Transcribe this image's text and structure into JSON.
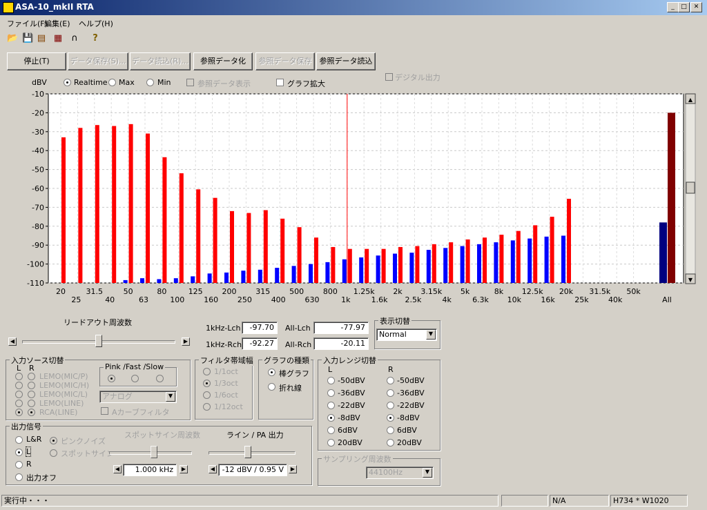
{
  "window": {
    "title": "ASA-10_mkII RTA"
  },
  "menu": [
    "ファイル(F)",
    "編集(E)",
    "ヘルプ(H)"
  ],
  "toolbar_buttons": [
    {
      "label": "停止(T)",
      "enabled": true
    },
    {
      "label": "データ保存(S)...",
      "enabled": false
    },
    {
      "label": "データ読込(R)...",
      "enabled": false
    },
    {
      "label": "参照データ化",
      "enabled": true
    },
    {
      "label": "参照データ保存",
      "enabled": false
    },
    {
      "label": "参照データ読込",
      "enabled": true
    }
  ],
  "digital_output": "デジタル出力",
  "display_mode": {
    "unit": "dBV",
    "options": [
      "Realtime",
      "Max",
      "Min"
    ],
    "selected": "Realtime",
    "ref_display": "参照データ表示",
    "graph_zoom": "グラフ拡大"
  },
  "chart_data": {
    "type": "bar",
    "ylim": [
      -110,
      -10
    ],
    "yticks": [
      -10,
      -20,
      -30,
      -40,
      -50,
      -60,
      -70,
      -80,
      -90,
      -100,
      -110
    ],
    "categories": [
      "20",
      "25",
      "31.5",
      "40",
      "50",
      "63",
      "80",
      "100",
      "125",
      "160",
      "200",
      "250",
      "315",
      "400",
      "500",
      "630",
      "800",
      "1k",
      "1.25k",
      "1.6k",
      "2k",
      "2.5k",
      "3.15k",
      "4k",
      "5k",
      "6.3k",
      "8k",
      "10k",
      "12.5k",
      "16k",
      "20k",
      "25k",
      "31.5k",
      "40k",
      "50k"
    ],
    "series": [
      {
        "values": [
          -110,
          -110,
          -110,
          -110,
          -108.5,
          -107.5,
          -108,
          -107.5,
          -106.5,
          -105,
          -104.5,
          -103.5,
          -103,
          -102,
          -101,
          -100,
          -99,
          -97.5,
          -96.5,
          -95.5,
          -94.5,
          -94,
          -92.5,
          -91.5,
          -90.5,
          -89.5,
          -88.5,
          -87.5,
          -86.5,
          -85.5,
          -85,
          -110,
          -110,
          -110,
          -110
        ]
      },
      {
        "values": [
          -33,
          -28,
          -26.5,
          -27,
          -26,
          -31,
          -43.5,
          -52,
          -60.5,
          -65,
          -72,
          -73,
          -71.5,
          -76,
          -80.5,
          -86,
          -91,
          -92,
          -92,
          -92,
          -91,
          -90.5,
          -89.5,
          -88.5,
          -87,
          -86,
          -84.5,
          -82.5,
          -79.5,
          -75,
          -65.5,
          -110,
          -110,
          -110,
          -110
        ]
      }
    ],
    "all": {
      "label": "All",
      "blue": -78,
      "red": -20
    },
    "cursor_at": "1k"
  },
  "readout": {
    "lch_1k_label": "1kHz-Lch",
    "lch_1k": "-97.70",
    "rch_1k_label": "1kHz-Rch",
    "rch_1k": "-92.27",
    "lch_all_label": "All-Lch",
    "lch_all": "-77.97",
    "rch_all_label": "All-Rch",
    "rch_all": "-20.11"
  },
  "readout_freq": {
    "label": "リードアウト周波数"
  },
  "display_switch": {
    "title": "表示切替",
    "value": "Normal"
  },
  "input_source": {
    "title": "入力ソース切替",
    "l": "L",
    "r": "R",
    "items": [
      "LEMO(MIC/P)",
      "LEMO(MIC/H)",
      "LEMO(MIC/L)",
      "LEMO(LINE)",
      "RCA(LINE)"
    ],
    "pink_title": "Pink /Fast /Slow",
    "analog": "アナログ",
    "a_filter": "Aカーブフィルタ"
  },
  "filter_bw": {
    "title": "フィルタ帯域幅",
    "items": [
      "1/1oct",
      "1/3oct",
      "1/6oct",
      "1/12oct"
    ]
  },
  "graph_type": {
    "title": "グラフの種類",
    "items": [
      "棒グラフ",
      "折れ線"
    ]
  },
  "input_range": {
    "title": "入力レンジ切替",
    "l": "L",
    "r": "R",
    "items": [
      "-50dBV",
      "-36dBV",
      "-22dBV",
      "-8dBV",
      "6dBV",
      "20dBV"
    ],
    "selected": "-8dBV"
  },
  "sampling": {
    "title": "サンプリング周波数",
    "value": "44100Hz"
  },
  "output_signal": {
    "title": "出力信号",
    "items": [
      "L&R",
      "L",
      "R",
      "出力オフ"
    ],
    "selected": "L",
    "pink": "ピンクノイズ",
    "spot": "スポットサイン",
    "spot_freq_title": "スポットサイン周波数",
    "spot_freq": "1.000 kHz",
    "line_pa_title": "ライン / PA 出力",
    "line_pa": "-12 dBV / 0.95 V"
  },
  "status": {
    "text": "実行中・・・",
    "na": "N/A",
    "size": "H734 * W1020"
  }
}
